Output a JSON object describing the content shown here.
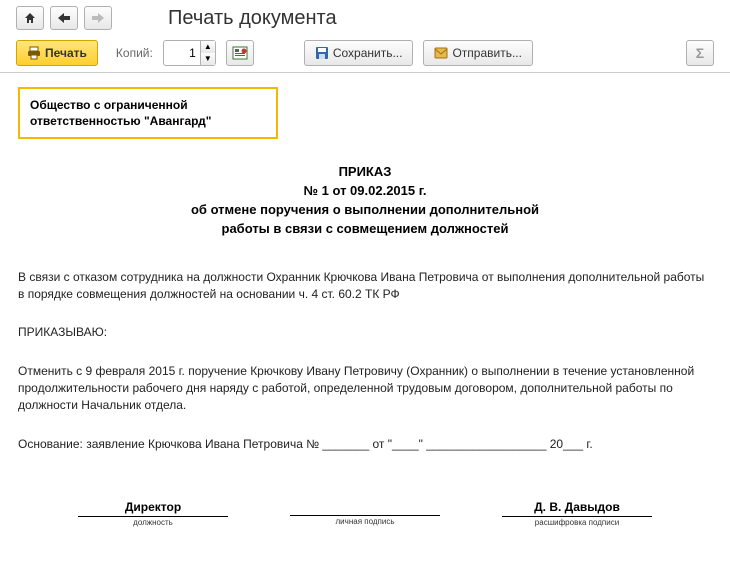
{
  "window": {
    "title": "Печать документа"
  },
  "toolbar": {
    "print_label": "Печать",
    "copies_label": "Копий:",
    "copies_value": "1",
    "save_label": "Сохранить...",
    "send_label": "Отправить..."
  },
  "document": {
    "org_line1": "Общество с ограниченной",
    "org_line2": "ответственностью \"Авангард\"",
    "heading1": "ПРИКАЗ",
    "heading2": "№ 1 от 09.02.2015 г.",
    "heading3": "об отмене поручения о выполнении дополнительной",
    "heading4": "работы в связи с совмещением должностей",
    "para1": "В связи с отказом сотрудника на должности Охранник Крючкова Ивана Петровича от выполнения дополнительной работы в порядке совмещения должностей на основании ч. 4 ст. 60.2 ТК РФ",
    "para2": "ПРИКАЗЫВАЮ:",
    "para3": "Отменить с 9 февраля 2015 г. поручение Крючкову Ивану Петровичу (Охранник) о выполнении в течение установленной продолжительности рабочего дня наряду с работой, определенной трудовым договором, дополнительной работы по должности Начальник отдела.",
    "para4": "Основание: заявление Крючкова Ивана Петровича № _______  от \"____\"  __________________ 20___  г.",
    "sig": {
      "col1_main": "Директор",
      "col1_sub": "должность",
      "col2_main": "",
      "col2_sub": "личная подпись",
      "col3_main": "Д. В. Давыдов",
      "col3_sub": "расшифровка подписи"
    }
  }
}
